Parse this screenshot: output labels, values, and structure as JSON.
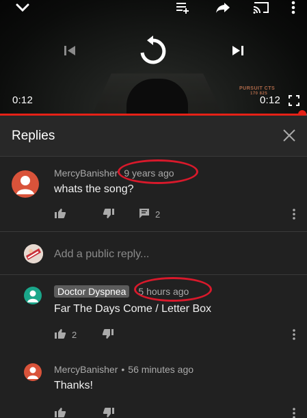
{
  "player": {
    "current_time": "0:12",
    "duration": "0:12",
    "hud_text": "PURSUIT CTS",
    "hud_sub": "170 825",
    "progress": 0.985,
    "accent": "#e62117",
    "icons": [
      "chevron-down-icon",
      "add-to-queue-icon",
      "share-icon",
      "cast-icon",
      "more-vert-icon",
      "skip-previous-icon",
      "replay-icon",
      "skip-next-icon",
      "fullscreen-icon"
    ]
  },
  "replies": {
    "title": "Replies",
    "close_icon": "close-icon",
    "reply_placeholder": "Add a public reply..."
  },
  "comments": [
    {
      "author": "MercyBanisher",
      "time": "9 years ago",
      "text": "whats the song?",
      "likes": "",
      "reply_count": "2",
      "avatar_color": "#d9533a"
    },
    {
      "author": "Doctor Dyspnea",
      "time": "5 hours ago",
      "text": "Far The Days Come / Letter Box",
      "likes": "2",
      "avatar_color": "#1aa68a"
    },
    {
      "author": "MercyBanisher",
      "separator": "•",
      "time": "56 minutes ago",
      "text": "Thanks!",
      "likes": "",
      "avatar_color": "#d9533a"
    }
  ],
  "annotation_color": "#d8192b"
}
